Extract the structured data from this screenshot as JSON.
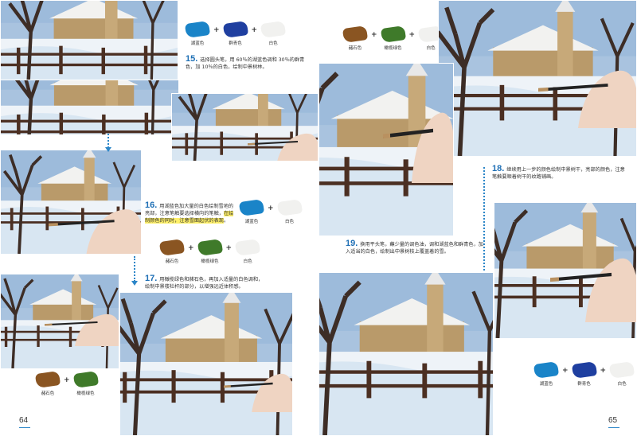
{
  "left_page": {
    "page_number": "64",
    "step15": {
      "number": "15.",
      "text": "选择圆头笔，用 60％的湖蓝色调和 30％的群青色，加 10％的白色，绘制中景树林。",
      "swatches": [
        {
          "label": "湖蓝色",
          "color": "#1a84c8"
        },
        {
          "label": "群青色",
          "color": "#1f3fa0"
        },
        {
          "label": "白色",
          "color": "#f1f1ef"
        }
      ]
    },
    "step16": {
      "number": "16.",
      "text_before": "用湖蓝色加大量的白色绘制雪地的亮部，注意笔触要选择横向的笔触，",
      "text_highlight": "在绘制颜色的同时，注意雪面起伏的表现",
      "text_after": "。",
      "swatches_row1": [
        {
          "label": "湖蓝色",
          "color": "#1a84c8"
        },
        {
          "label": "白色",
          "color": "#f1f1ef"
        }
      ],
      "swatches_row2": [
        {
          "label": "赭石色",
          "color": "#8a5522"
        },
        {
          "label": "橄榄绿色",
          "color": "#3f7a2a"
        },
        {
          "label": "白色",
          "color": "#f1f1ef"
        }
      ]
    },
    "step17": {
      "number": "17.",
      "text": "用橄榄绿色和赭石色，再加入适量的白色调和，绘制中景楼栏杆的部分，以增强远近体积感。",
      "swatches": [
        {
          "label": "赭石色",
          "color": "#8a5522"
        },
        {
          "label": "橄榄绿色",
          "color": "#3f7a2a"
        }
      ]
    }
  },
  "right_page": {
    "page_number": "65",
    "top_swatches": [
      {
        "label": "赭石色",
        "color": "#8a5522"
      },
      {
        "label": "橄榄绿色",
        "color": "#3f7a2a"
      },
      {
        "label": "白色",
        "color": "#f1f1ef"
      }
    ],
    "step18": {
      "number": "18.",
      "text": "继续用上一步的颜色绘制中景树干，亮部的颜色，注意笔触要顺着树干的纹路铺画。"
    },
    "step19": {
      "number": "19.",
      "text": "换用平头笔，蘸少量的调色油，调和湖蓝色和群青色，加入适当的白色，绘制出中景树枝上覆盖着的雪。"
    },
    "bottom_swatches": [
      {
        "label": "湖蓝色",
        "color": "#1a84c8"
      },
      {
        "label": "群青色",
        "color": "#1f3fa0"
      },
      {
        "label": "白色",
        "color": "#f1f1ef"
      }
    ]
  }
}
